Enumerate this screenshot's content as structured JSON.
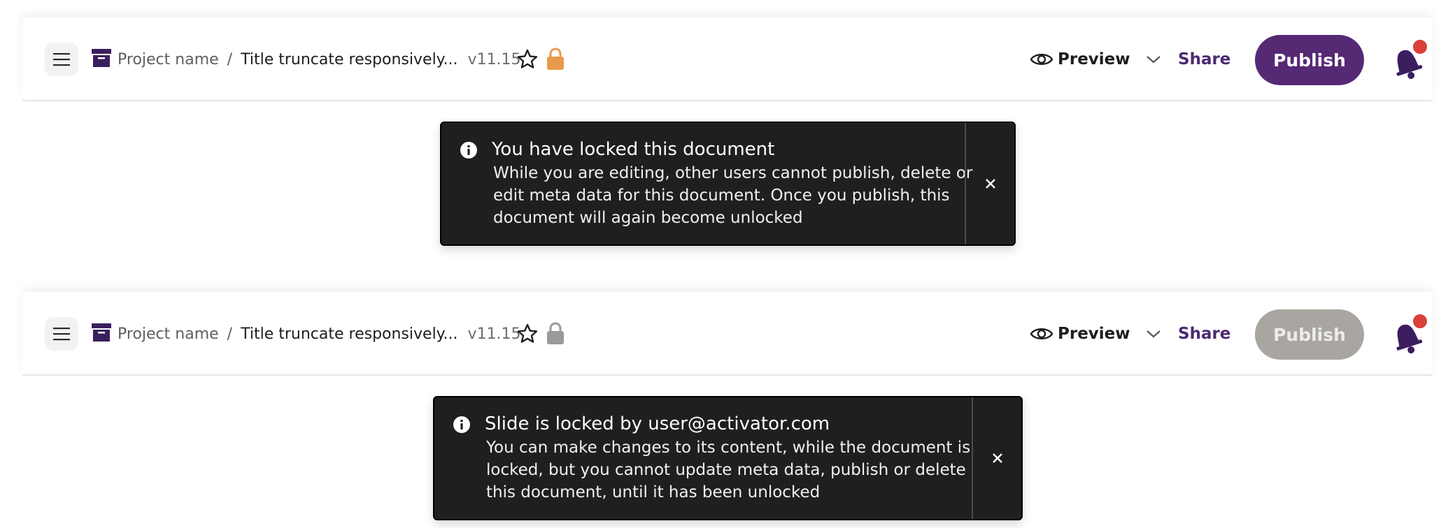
{
  "panels": [
    {
      "header": {
        "project_name": "Project name",
        "separator": "/",
        "title": "Title truncate responsively...",
        "version": "v11.15",
        "lock_state": "locked-by-me",
        "preview_label": "Preview",
        "share_label": "Share",
        "publish_label": "Publish",
        "publish_enabled": true,
        "notification_dot": true
      },
      "toast": {
        "title": "You have locked this document",
        "body": "While you are editing, other users cannot publish, delete or edit meta data for this document. Once you publish, this document will again become unlocked"
      }
    },
    {
      "header": {
        "project_name": "Project name",
        "separator": "/",
        "title": "Title truncate responsively...",
        "version": "v11.15",
        "lock_state": "locked-by-other",
        "preview_label": "Preview",
        "share_label": "Share",
        "publish_label": "Publish",
        "publish_enabled": false,
        "notification_dot": true
      },
      "toast": {
        "title": "Slide is locked by user@activator.com",
        "body": "You can make changes to its content, while the document is locked, but you cannot update meta data, publish or delete this document, until it has been unlocked"
      }
    }
  ],
  "icons": {
    "menu": "hamburger-menu-icon",
    "archive": "archive-box-icon",
    "star": "star-outline-icon",
    "lock": "padlock-icon",
    "eye": "eye-icon",
    "chevron": "chevron-down-icon",
    "bell": "bell-icon",
    "info": "info-circle-icon",
    "close": "close-x-icon"
  },
  "colors": {
    "brand_purple": "#562974",
    "share_text": "#4a2a73",
    "lock_mine": "#e89a4c",
    "lock_other": "#9a9a9a",
    "publish_disabled": "#a9a6a1",
    "notification_dot": "#d9403a",
    "toast_bg": "#1f1f1f"
  }
}
